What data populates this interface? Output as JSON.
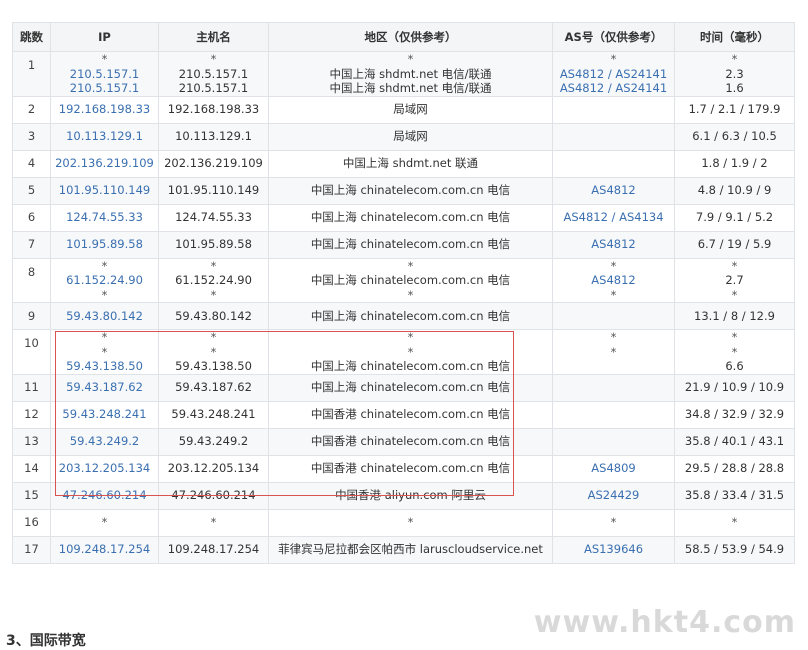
{
  "headers": [
    "跳数",
    "IP",
    "主机名",
    "地区（仅供参考）",
    "AS号（仅供参考）",
    "时间（毫秒）"
  ],
  "rows": [
    {
      "hop": "1",
      "ip": [
        "*",
        "210.5.157.1",
        "210.5.157.1"
      ],
      "host": [
        "*",
        "210.5.157.1",
        "210.5.157.1"
      ],
      "region": [
        "*",
        "中国上海 shdmt.net 电信/联通",
        "中国上海 shdmt.net 电信/联通"
      ],
      "as": [
        "*",
        "AS4812 / AS24141",
        "AS4812 / AS24141"
      ],
      "time": [
        "*",
        "2.3",
        "1.6"
      ]
    },
    {
      "hop": "2",
      "ip": [
        "192.168.198.33"
      ],
      "host": [
        "192.168.198.33"
      ],
      "region": [
        "局域网"
      ],
      "as": [
        ""
      ],
      "time": [
        "1.7 / 2.1 / 179.9"
      ]
    },
    {
      "hop": "3",
      "ip": [
        "10.113.129.1"
      ],
      "host": [
        "10.113.129.1"
      ],
      "region": [
        "局域网"
      ],
      "as": [
        ""
      ],
      "time": [
        "6.1 / 6.3 / 10.5"
      ]
    },
    {
      "hop": "4",
      "ip": [
        "202.136.219.109"
      ],
      "host": [
        "202.136.219.109"
      ],
      "region": [
        "中国上海 shdmt.net 联通"
      ],
      "as": [
        ""
      ],
      "time": [
        "1.8 / 1.9 / 2"
      ]
    },
    {
      "hop": "5",
      "ip": [
        "101.95.110.149"
      ],
      "host": [
        "101.95.110.149"
      ],
      "region": [
        "中国上海 chinatelecom.com.cn 电信"
      ],
      "as": [
        "AS4812"
      ],
      "time": [
        "4.8 / 10.9 / 9"
      ]
    },
    {
      "hop": "6",
      "ip": [
        "124.74.55.33"
      ],
      "host": [
        "124.74.55.33"
      ],
      "region": [
        "中国上海 chinatelecom.com.cn 电信"
      ],
      "as": [
        "AS4812 / AS4134"
      ],
      "time": [
        "7.9 / 9.1 / 5.2"
      ]
    },
    {
      "hop": "7",
      "ip": [
        "101.95.89.58"
      ],
      "host": [
        "101.95.89.58"
      ],
      "region": [
        "中国上海 chinatelecom.com.cn 电信"
      ],
      "as": [
        "AS4812"
      ],
      "time": [
        "6.7 / 19 / 5.9"
      ]
    },
    {
      "hop": "8",
      "ip": [
        "*",
        "61.152.24.90",
        "*"
      ],
      "host": [
        "*",
        "61.152.24.90",
        "*"
      ],
      "region": [
        "*",
        "中国上海 chinatelecom.com.cn 电信",
        "*"
      ],
      "as": [
        "*",
        "AS4812",
        "*"
      ],
      "time": [
        "*",
        "2.7",
        "*"
      ]
    },
    {
      "hop": "9",
      "ip": [
        "59.43.80.142"
      ],
      "host": [
        "59.43.80.142"
      ],
      "region": [
        "中国上海 chinatelecom.com.cn 电信"
      ],
      "as": [
        ""
      ],
      "time": [
        "13.1 / 8 / 12.9"
      ]
    },
    {
      "hop": "10",
      "ip": [
        "*",
        "*",
        "59.43.138.50"
      ],
      "host": [
        "*",
        "*",
        "59.43.138.50"
      ],
      "region": [
        "*",
        "*",
        "中国上海 chinatelecom.com.cn 电信"
      ],
      "as": [
        "*",
        "*",
        ""
      ],
      "time": [
        "*",
        "*",
        "6.6"
      ]
    },
    {
      "hop": "11",
      "ip": [
        "59.43.187.62"
      ],
      "host": [
        "59.43.187.62"
      ],
      "region": [
        "中国上海 chinatelecom.com.cn 电信"
      ],
      "as": [
        ""
      ],
      "time": [
        "21.9 / 10.9 / 10.9"
      ]
    },
    {
      "hop": "12",
      "ip": [
        "59.43.248.241"
      ],
      "host": [
        "59.43.248.241"
      ],
      "region": [
        "中国香港 chinatelecom.com.cn 电信"
      ],
      "as": [
        ""
      ],
      "time": [
        "34.8 / 32.9 / 32.9"
      ]
    },
    {
      "hop": "13",
      "ip": [
        "59.43.249.2"
      ],
      "host": [
        "59.43.249.2"
      ],
      "region": [
        "中国香港 chinatelecom.com.cn 电信"
      ],
      "as": [
        ""
      ],
      "time": [
        "35.8 / 40.1 / 43.1"
      ]
    },
    {
      "hop": "14",
      "ip": [
        "203.12.205.134"
      ],
      "host": [
        "203.12.205.134"
      ],
      "region": [
        "中国香港 chinatelecom.com.cn 电信"
      ],
      "as": [
        "AS4809"
      ],
      "time": [
        "29.5 / 28.8 / 28.8"
      ]
    },
    {
      "hop": "15",
      "ip": [
        "47.246.60.214"
      ],
      "host": [
        "47.246.60.214"
      ],
      "region": [
        "中国香港 aliyun.com 阿里云"
      ],
      "as": [
        "AS24429"
      ],
      "time": [
        "35.8 / 33.4 / 31.5"
      ]
    },
    {
      "hop": "16",
      "ip": [
        "*"
      ],
      "host": [
        "*"
      ],
      "region": [
        "*"
      ],
      "as": [
        "*"
      ],
      "time": [
        "*"
      ]
    },
    {
      "hop": "17",
      "ip": [
        "109.248.17.254"
      ],
      "host": [
        "109.248.17.254"
      ],
      "region": [
        "菲律宾马尼拉都会区帕西市 laruscloudservice.net"
      ],
      "as": [
        "AS139646"
      ],
      "time": [
        "58.5 / 53.9 / 54.9"
      ]
    }
  ],
  "section_title": "3、国际带宽",
  "watermark": "www.hkt4.com",
  "colors": {
    "link": "#3a6fb0",
    "highlight": "#d9534f",
    "header_bg": "#f3f5f7"
  }
}
